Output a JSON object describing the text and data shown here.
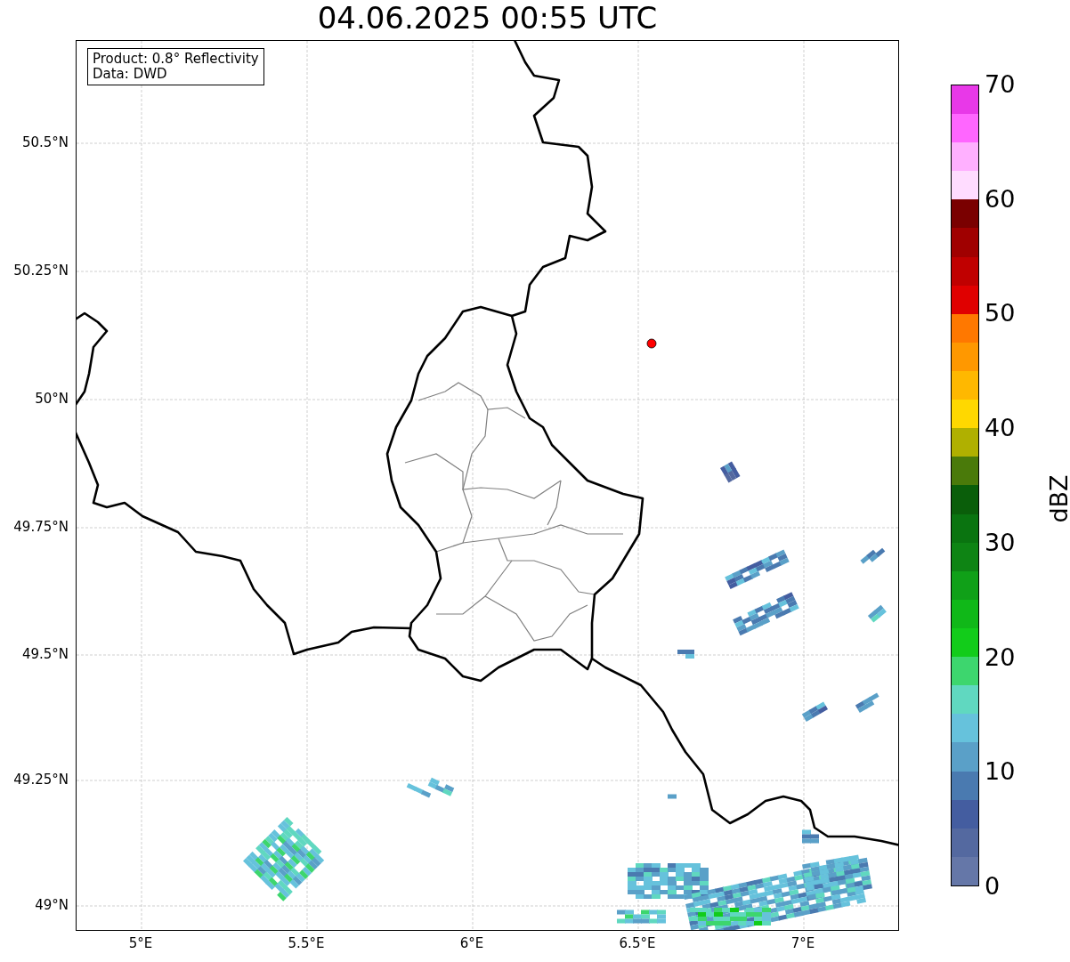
{
  "title": "04.06.2025 00:55 UTC",
  "info_box": [
    "Product: 0.8° Reflectivity",
    "Data: DWD"
  ],
  "y_ticks": [
    "50.5°N",
    "50.25°N",
    "50°N",
    "49.75°N",
    "49.5°N",
    "49.25°N",
    "49°N"
  ],
  "x_ticks": [
    "5°E",
    "5.5°E",
    "6°E",
    "6.5°E",
    "7°E"
  ],
  "colorbar": {
    "label": "dBZ",
    "ticks": [
      "70",
      "60",
      "50",
      "40",
      "30",
      "20",
      "10",
      "0"
    ],
    "bins": [
      {
        "color": "#6577a8"
      },
      {
        "color": "#5469a0"
      },
      {
        "color": "#445da0"
      },
      {
        "color": "#4a7ab0"
      },
      {
        "color": "#5aa0c8"
      },
      {
        "color": "#66c2dc"
      },
      {
        "color": "#60d8c0"
      },
      {
        "color": "#3dd66e"
      },
      {
        "color": "#12cc1a"
      },
      {
        "color": "#10b818"
      },
      {
        "color": "#10a018"
      },
      {
        "color": "#0e8414"
      },
      {
        "color": "#0a7410"
      },
      {
        "color": "#0a5e0a"
      },
      {
        "color": "#4a7a0a"
      },
      {
        "color": "#b0b000"
      },
      {
        "color": "#ffd800"
      },
      {
        "color": "#ffb800"
      },
      {
        "color": "#ff9800"
      },
      {
        "color": "#ff7800"
      },
      {
        "color": "#e00000"
      },
      {
        "color": "#c00000"
      },
      {
        "color": "#a00000"
      },
      {
        "color": "#7a0000"
      },
      {
        "color": "#ffdcff"
      },
      {
        "color": "#ffb0ff"
      },
      {
        "color": "#ff66ff"
      },
      {
        "color": "#e838e8"
      }
    ]
  }
}
